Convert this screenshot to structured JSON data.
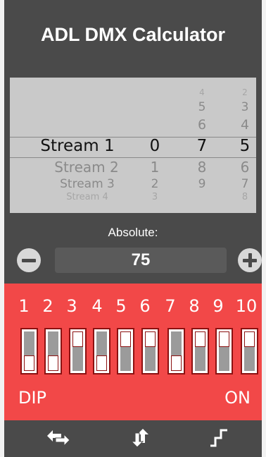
{
  "header": {
    "title": "ADL DMX Calculator"
  },
  "picker": {
    "streams": [
      "Stream 1",
      "Stream 2",
      "Stream 3",
      "Stream 4"
    ],
    "wheel_hundreds": [
      "0",
      "1",
      "2",
      "3"
    ],
    "wheel_tens_above": [
      "4",
      "5",
      "6"
    ],
    "wheel_tens": [
      "7",
      "8",
      "9"
    ],
    "wheel_ones_above": [
      "2",
      "3",
      "4"
    ],
    "wheel_ones": [
      "5",
      "6",
      "7",
      "8"
    ]
  },
  "absolute": {
    "label": "Absolute:",
    "value": "75"
  },
  "dip": {
    "numbers": [
      "1",
      "2",
      "3",
      "4",
      "5",
      "6",
      "7",
      "8",
      "9",
      "10"
    ],
    "states": [
      "off",
      "off",
      "on",
      "off",
      "on",
      "on",
      "off",
      "on",
      "on",
      "on"
    ],
    "left_label": "DIP",
    "right_label": "ON"
  },
  "colors": {
    "panel_red": "#f24848",
    "background": "#4a4a4a",
    "picker_bg": "#c9c9c9"
  },
  "toolbar": {
    "icons": [
      "swap-horizontal-icon",
      "swap-vertical-icon",
      "step-signal-icon"
    ]
  }
}
